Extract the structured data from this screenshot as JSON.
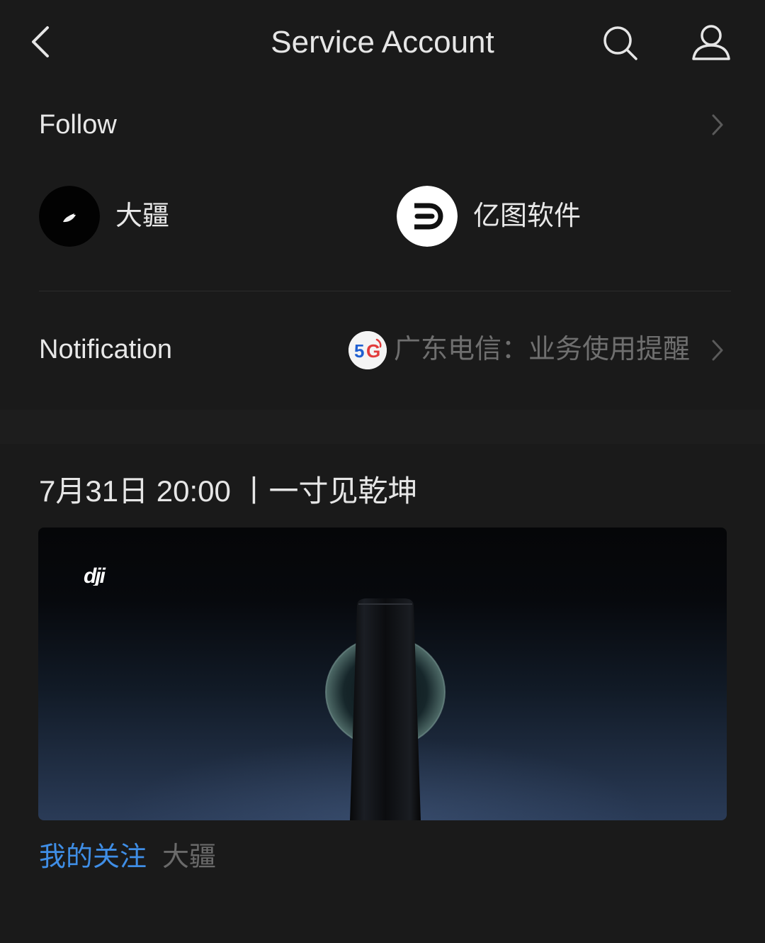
{
  "nav": {
    "title": "Service Account"
  },
  "follow": {
    "title": "Follow",
    "accounts": [
      {
        "name": "大疆"
      },
      {
        "name": "亿图软件"
      }
    ]
  },
  "notification": {
    "title": "Notification",
    "badge": "5G",
    "preview": "广东电信：业务使用提醒"
  },
  "article": {
    "title": "7月31日 20:00 丨一寸见乾坤",
    "image_logo": "dji",
    "tag_follow": "我的关注",
    "author": "大疆"
  },
  "colors": {
    "background": "#1a1a1a",
    "text": "#e8e8e8",
    "muted": "#6f6f6f",
    "link": "#3f8ee6"
  },
  "icons": [
    "back-icon",
    "search-icon",
    "profile-icon",
    "chevron-right-icon"
  ]
}
